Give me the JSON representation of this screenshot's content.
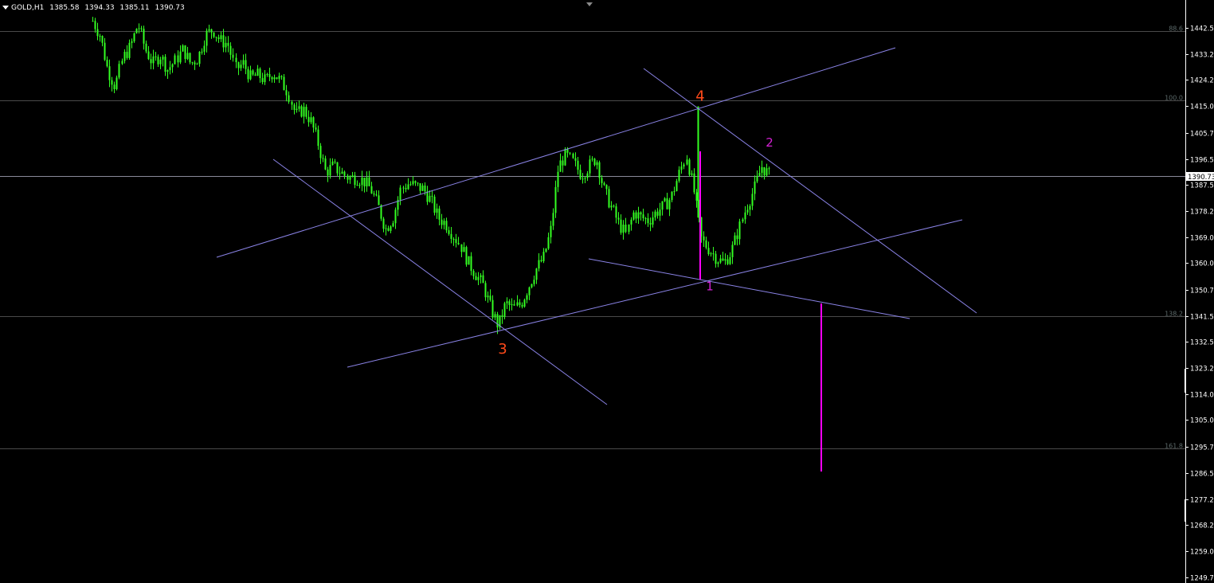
{
  "header": {
    "symbol": "GOLD,H1",
    "ohlc": [
      "1385.58",
      "1394.33",
      "1385.11",
      "1390.73"
    ]
  },
  "chart_data": {
    "type": "candlestick",
    "symbol": "GOLD",
    "timeframe": "H1",
    "ylim": [
      1249.78,
      1449.0
    ],
    "price_axis_ticks": [
      "1442.53",
      "1433.28",
      "1424.28",
      "1415.03",
      "1405.78",
      "1396.53",
      "1387.53",
      "1378.28",
      "1369.03",
      "1360.03",
      "1350.78",
      "1341.53",
      "1332.53",
      "1323.28",
      "1314.03",
      "1305.03",
      "1295.78",
      "1286.53",
      "1277.28",
      "1268.28",
      "1259.03",
      "1249.78"
    ],
    "current_price": "1390.73",
    "fib_levels": [
      {
        "label": "88.6",
        "price": 1441.3
      },
      {
        "label": "100.0",
        "price": 1417.0
      },
      {
        "label": "138.2",
        "price": 1341.5
      },
      {
        "label": "161.8",
        "price": 1295.0
      }
    ],
    "wave_points": [
      {
        "label": "4",
        "price": 1415.03,
        "color": "#ff4a1a"
      },
      {
        "label": "2",
        "price": 1397.0,
        "color": "#d321d3"
      },
      {
        "label": "1",
        "price": 1355.0,
        "color": "#d321d3"
      },
      {
        "label": "3",
        "price": 1337.5,
        "color": "#ff4a1a"
      }
    ],
    "price_path": [
      1445,
      1440,
      1428,
      1422,
      1432,
      1436,
      1444,
      1435,
      1430,
      1433,
      1428,
      1431,
      1435,
      1430,
      1432,
      1440,
      1442,
      1438,
      1437,
      1428,
      1430,
      1425,
      1426,
      1424,
      1427,
      1424,
      1420,
      1412,
      1414,
      1410,
      1402,
      1392,
      1394,
      1392,
      1390,
      1390,
      1389,
      1386,
      1380,
      1372,
      1376,
      1386,
      1388,
      1387,
      1386,
      1382,
      1376,
      1374,
      1370,
      1366,
      1360,
      1356,
      1352,
      1344,
      1338,
      1346,
      1344,
      1346,
      1352,
      1358,
      1362,
      1372,
      1394,
      1398,
      1395,
      1391,
      1394,
      1397,
      1386,
      1380,
      1374,
      1370,
      1378,
      1376,
      1375,
      1378,
      1380,
      1383,
      1391,
      1398,
      1385,
      1368,
      1365,
      1362,
      1360,
      1364,
      1372,
      1380,
      1386,
      1394,
      1391
    ],
    "colors": {
      "candle": "#33ff22",
      "channel": "#8a83e6",
      "target": "#ff00ff",
      "grid": "#4a4a4a"
    }
  }
}
